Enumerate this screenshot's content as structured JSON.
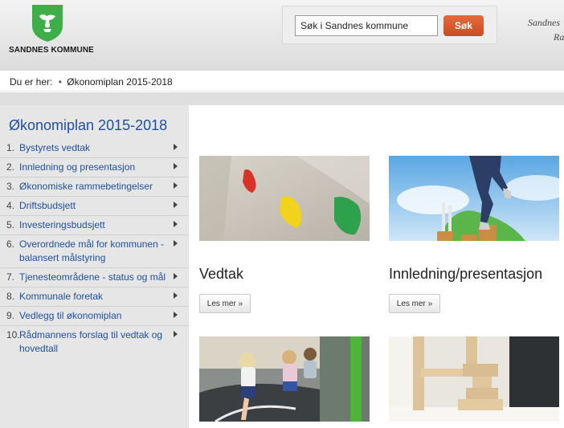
{
  "header": {
    "logo_text": "SANDNES KOMMUNE",
    "search_placeholder": "Søk i Sandnes kommune",
    "search_value": "Søk i Sandnes kommune",
    "search_button": "Søk",
    "right_line1": "Sandnes",
    "right_line2": "Ra"
  },
  "breadcrumb": {
    "label": "Du er her:",
    "separator": "•",
    "current": "Økonomiplan 2015-2018"
  },
  "sidebar": {
    "title": "Økonomiplan 2015-2018",
    "items": [
      {
        "num": "1.",
        "label": "Bystyrets vedtak"
      },
      {
        "num": "2.",
        "label": "Innledning og presentasjon"
      },
      {
        "num": "3.",
        "label": "Økonomiske rammebetingelser"
      },
      {
        "num": "4.",
        "label": "Driftsbudsjett"
      },
      {
        "num": "5.",
        "label": "Investeringsbudsjett"
      },
      {
        "num": "6.",
        "label": "Overordnede mål for kommunen - balansert målstyring"
      },
      {
        "num": "7.",
        "label": "Tjenesteområdene - status og mål"
      },
      {
        "num": "8.",
        "label": "Kommunale foretak"
      },
      {
        "num": "9.",
        "label": "Vedlegg til økonomiplan"
      },
      {
        "num": "10.",
        "label": "Rådmannens forslag til vedtak og hovedtall"
      }
    ]
  },
  "cards": [
    {
      "title": "Vedtak",
      "button": "Les mer »"
    },
    {
      "title": "Innledning/presentasjon",
      "button": "Les mer »"
    }
  ],
  "colors": {
    "link_blue": "#1f4f9e",
    "search_orange": "#d85a2e",
    "logo_green": "#3fae49"
  }
}
